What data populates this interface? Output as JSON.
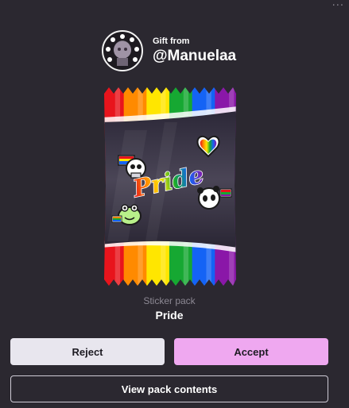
{
  "menu": {
    "dots_glyph": "···"
  },
  "gift": {
    "from_label": "Gift from",
    "username": "@Manuelaa"
  },
  "pack": {
    "art_text": "Pride",
    "type_label": "Sticker pack",
    "name": "Pride",
    "stripe_colors": [
      "#e8141c",
      "#ff8a00",
      "#ffe600",
      "#16a832",
      "#1463f5",
      "#8a17a8"
    ]
  },
  "buttons": {
    "reject": "Reject",
    "accept": "Accept",
    "view": "View pack contents"
  }
}
